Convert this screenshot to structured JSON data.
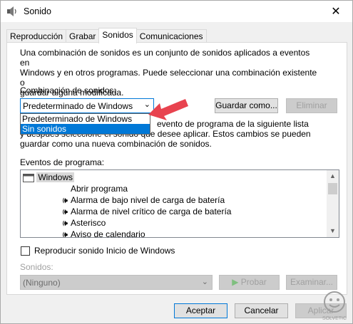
{
  "window": {
    "title": "Sonido",
    "close_glyph": "✕"
  },
  "tabs": [
    {
      "label": "Reproducción",
      "active": false
    },
    {
      "label": "Grabar",
      "active": false
    },
    {
      "label": "Sonidos",
      "active": true
    },
    {
      "label": "Comunicaciones",
      "active": false
    }
  ],
  "intro_lines": [
    "Una combinación de sonidos es un conjunto de sonidos aplicados a eventos en",
    "Windows y en otros programas. Puede seleccionar una combinación existente o",
    "guardar alguna modificada."
  ],
  "scheme": {
    "label": "Combinación de sonidos:",
    "value": "Predeterminado de Windows",
    "options": [
      "Predeterminado de Windows",
      "Sin sonidos"
    ],
    "selected_option": "Sin sonidos",
    "save_button": "Guardar como...",
    "delete_button": "Eliminar"
  },
  "hint_lines": [
    "evento de programa de la siguiente lista",
    "y después seleccione el sonido que desee aplicar. Estos cambios se pueden",
    "guardar como una nueva combinación de sonidos."
  ],
  "events": {
    "label": "Eventos de programa:",
    "group": "Windows",
    "items": [
      {
        "label": "Abrir programa",
        "has_sound": false
      },
      {
        "label": "Alarma de bajo nivel de carga de batería",
        "has_sound": true
      },
      {
        "label": "Alarma de nivel crítico de carga de batería",
        "has_sound": true
      },
      {
        "label": "Asterisco",
        "has_sound": true
      },
      {
        "label": "Aviso de calendario",
        "has_sound": true
      }
    ]
  },
  "startup_sound": {
    "label": "Reproducir sonido Inicio de Windows",
    "checked": false
  },
  "sounds": {
    "label": "Sonidos:",
    "value": "(Ninguno)",
    "test_button": "Probar",
    "browse_button": "Examinar..."
  },
  "footer": {
    "ok": "Aceptar",
    "cancel": "Cancelar",
    "apply": "Aplicar"
  },
  "colors": {
    "accent": "#0078d7",
    "pointer_arrow": "#e8434f",
    "watermark": "#9e9e9e"
  },
  "watermark_text": "SOLVETIC"
}
